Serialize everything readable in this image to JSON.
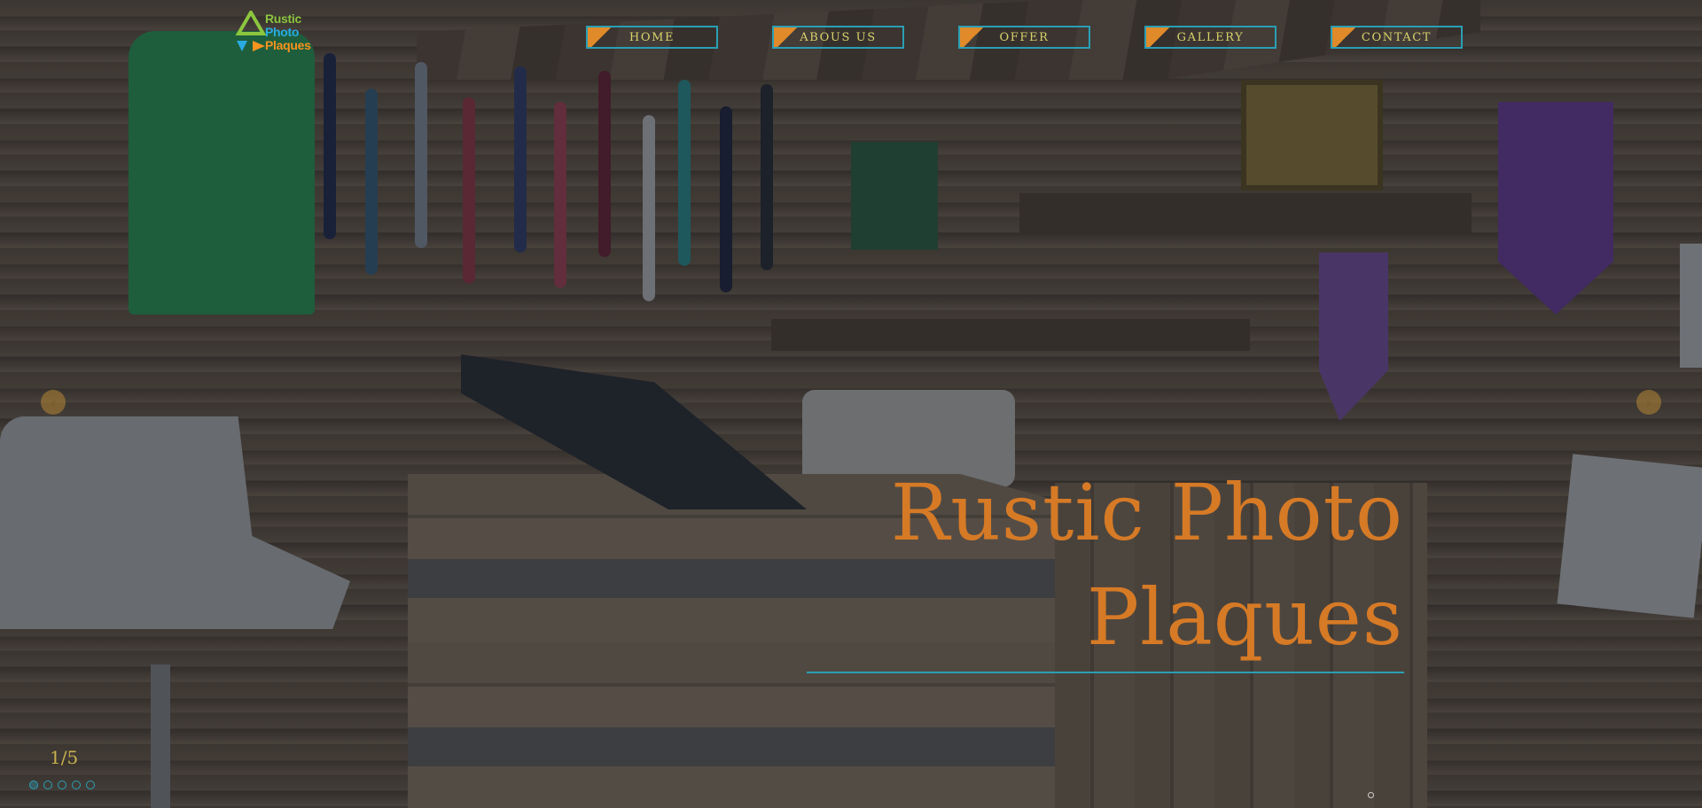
{
  "logo": {
    "line1": "Rustic",
    "line2": "Photo",
    "line3": "Plaques",
    "colors": [
      "#8cc63f",
      "#29abe2",
      "#f7931e"
    ]
  },
  "nav": {
    "items": [
      {
        "label": "HOME"
      },
      {
        "label": "ABOUS US"
      },
      {
        "label": "OFFER"
      },
      {
        "label": "GALLERY"
      },
      {
        "label": "CONTACT"
      }
    ]
  },
  "slider": {
    "prev_icon": "chevron-left-icon",
    "next_icon": "chevron-right-icon",
    "counter": "1/5",
    "current": 1,
    "total": 5
  },
  "hero": {
    "title_line1": "Rustic Photo",
    "title_line2": "Plaques"
  },
  "colors": {
    "accent_orange": "#d67a26",
    "accent_teal": "#2a9fb5",
    "nav_text": "#d8d36a",
    "counter_text": "#c9b04e"
  }
}
